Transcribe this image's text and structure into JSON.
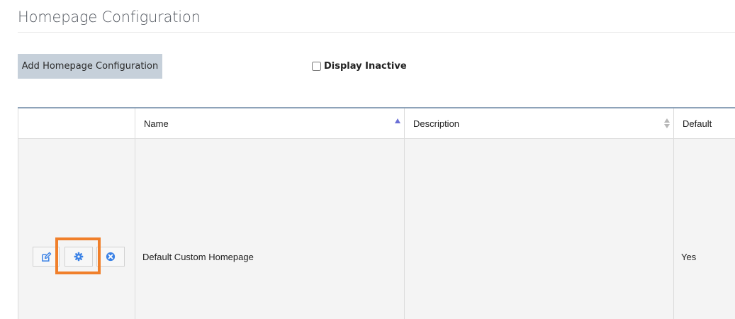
{
  "page": {
    "title": "Homepage Configuration"
  },
  "toolbar": {
    "add_label": "Add Homepage Configuration",
    "display_inactive_label": "Display Inactive",
    "display_inactive_checked": false
  },
  "table": {
    "columns": [
      {
        "label": "",
        "key": "actions"
      },
      {
        "label": "Name",
        "key": "name",
        "sort": "ascending"
      },
      {
        "label": "Description",
        "key": "description",
        "sort": "sortable"
      },
      {
        "label": "Default",
        "key": "default"
      }
    ],
    "rows": [
      {
        "name": "Default Custom Homepage",
        "description": "",
        "default": "Yes",
        "actions": [
          "edit-icon",
          "gear-icon",
          "close-circle-icon"
        ],
        "highlighted_action": "gear-icon"
      }
    ]
  },
  "colors": {
    "icon_blue": "#3b82e6",
    "highlight_orange": "#f07f2a",
    "button_bg": "#c6d0da",
    "header_border": "#8ea3b9"
  }
}
